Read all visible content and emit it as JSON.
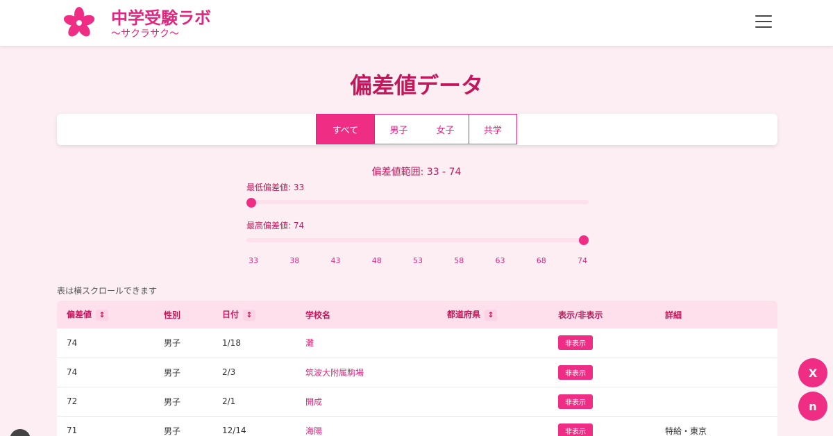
{
  "header": {
    "title": "中学受験ラボ",
    "subtitle": "〜サクラサク〜"
  },
  "page": {
    "title": "偏差値データ",
    "scroll_note": "表は横スクロールできます"
  },
  "filters": {
    "tabs": [
      {
        "label": "すべて",
        "active": true
      },
      {
        "label": "男子",
        "active": false
      },
      {
        "label": "女子",
        "active": false
      },
      {
        "label": "共学",
        "active": false
      }
    ]
  },
  "range": {
    "label": "偏差値範囲: 33 - 74",
    "min_label": "最低偏差値: 33",
    "max_label": "最高偏差値: 74",
    "min_value": 33,
    "max_value": 74,
    "scale_min": 33,
    "scale_max": 74,
    "ticks": [
      "33",
      "38",
      "43",
      "48",
      "53",
      "58",
      "63",
      "68",
      "74"
    ]
  },
  "table": {
    "columns": [
      "偏差値",
      "性別",
      "日付",
      "学校名",
      "都道府県",
      "表示/非表示",
      "詳細"
    ],
    "sort_symbol": "↕",
    "hide_label": "非表示",
    "rows": [
      {
        "score": "74",
        "gender": "男子",
        "date": "1/18",
        "school": "灘",
        "detail": ""
      },
      {
        "score": "74",
        "gender": "男子",
        "date": "2/3",
        "school": "筑波大附属駒場",
        "detail": ""
      },
      {
        "score": "72",
        "gender": "男子",
        "date": "2/1",
        "school": "開成",
        "detail": ""
      },
      {
        "score": "71",
        "gender": "男子",
        "date": "12/14",
        "school": "海陽",
        "detail": "特給・東京"
      }
    ]
  },
  "social": [
    {
      "icon": "x-icon",
      "glyph": "X"
    },
    {
      "icon": "note-icon",
      "glyph": "n"
    }
  ],
  "colors": {
    "accent": "#f02d84",
    "title": "#c2185b",
    "background": "#fceef3"
  }
}
